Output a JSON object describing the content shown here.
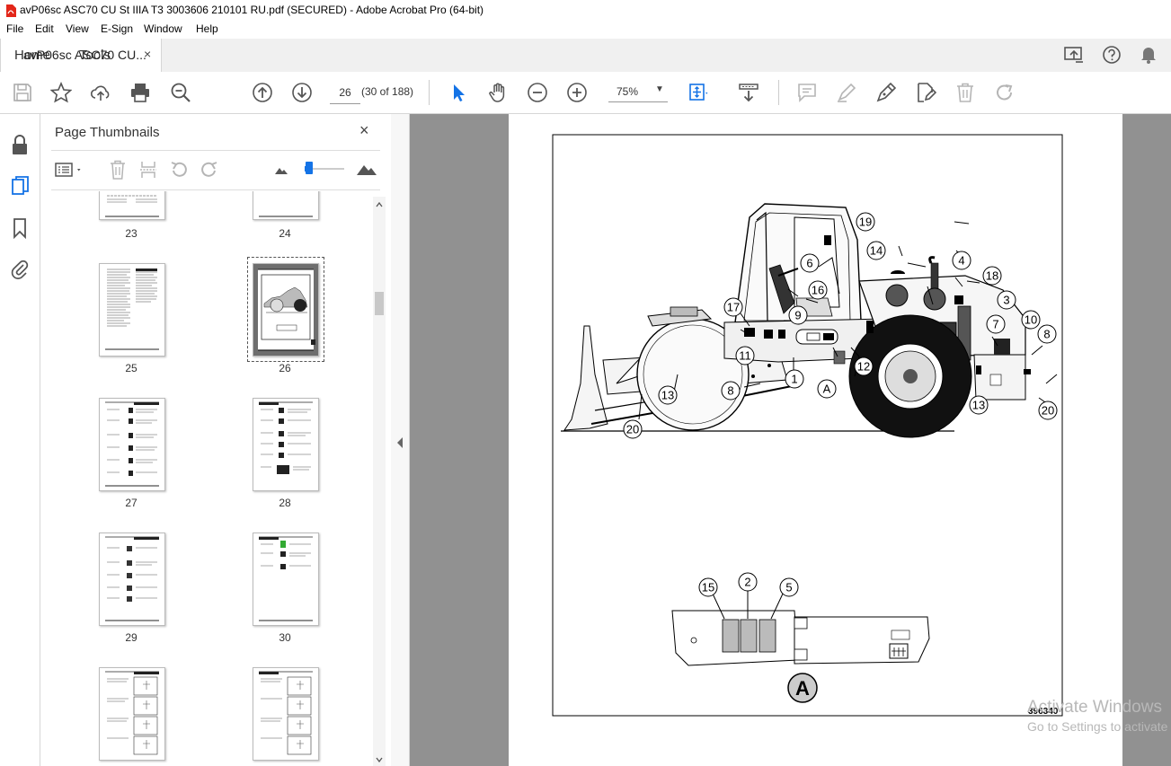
{
  "window": {
    "title": "avP06sc ASC70 CU St IIIA T3 3003606 210101 RU.pdf (SECURED) - Adobe Acrobat Pro (64-bit)"
  },
  "menu": [
    "File",
    "Edit",
    "View",
    "E-Sign",
    "Window",
    "Help"
  ],
  "tabs": {
    "home": "Home",
    "tools": "Tools",
    "document": "avP06sc ASC70 CU...",
    "close": "×"
  },
  "toolbar": {
    "page_current": "26",
    "page_count": "(30 of 188)",
    "zoom": "75%"
  },
  "thumbnails_panel": {
    "title": "Page Thumbnails",
    "close": "×",
    "pages": [
      "23",
      "24",
      "25",
      "26",
      "27",
      "28",
      "29",
      "30"
    ],
    "selected_page": "26"
  },
  "figure": {
    "callouts": [
      "19",
      "14",
      "6",
      "16",
      "4",
      "18",
      "3",
      "17",
      "9",
      "7",
      "10",
      "8",
      "11",
      "12",
      "1",
      "A",
      "13",
      "8",
      "13",
      "20",
      "20",
      "15",
      "2",
      "5"
    ],
    "detail_label": "A",
    "figure_number": "396340"
  },
  "watermark": {
    "line1": "Activate Windows",
    "line2": "Go to Settings to activate Windows."
  },
  "colors": {
    "accent_blue": "#1473e6",
    "toolbar_bg": "#f0f0f0",
    "doc_bg": "#919191",
    "icon_gray": "#555555",
    "disabled_icon": "#b5b5b5"
  }
}
